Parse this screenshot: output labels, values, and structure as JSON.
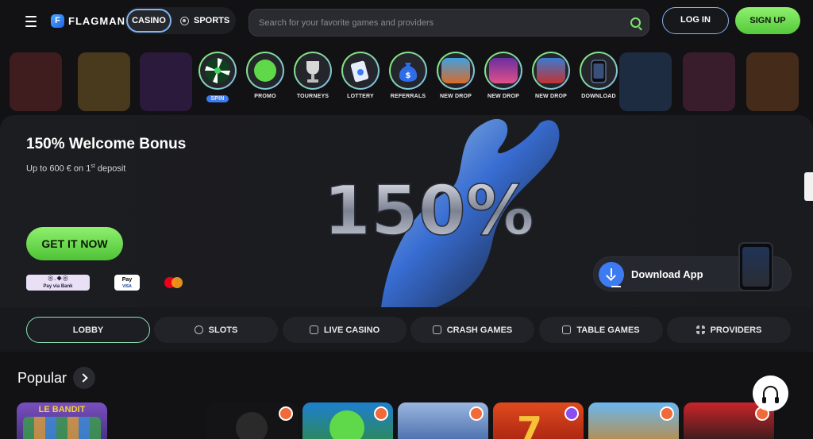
{
  "header": {
    "brand": "FLAGMAN",
    "brand_mark": "F",
    "mode_casino": "CASINO",
    "mode_sports": "SPORTS",
    "search_placeholder": "Search for your favorite games and providers",
    "login": "LOG IN",
    "signup": "SIGN UP"
  },
  "quick_links": [
    {
      "label": "SPIN",
      "icon": "wheel-icon",
      "color": "#1f8a3a"
    },
    {
      "label": "PROMO",
      "icon": "gift-icon",
      "color": "#5fd84a"
    },
    {
      "label": "TOURNEYS",
      "icon": "trophy-icon",
      "color": "#c9c9c9"
    },
    {
      "label": "LOTTERY",
      "icon": "ticket-icon",
      "color": "#9ab6e0"
    },
    {
      "label": "REFERRALS",
      "icon": "money-bag-icon",
      "color": "#2f6de8"
    },
    {
      "label": "NEW DROP",
      "icon": "game-thumb-icon",
      "color": "#d96b2a"
    },
    {
      "label": "NEW DROP",
      "icon": "game-thumb-icon",
      "color": "#a5285f"
    },
    {
      "label": "NEW DROP",
      "icon": "game-thumb-icon",
      "color": "#c23232"
    },
    {
      "label": "DOWNLOAD",
      "icon": "phone-icon",
      "color": "#3a4f7a"
    }
  ],
  "hero": {
    "title": "150% Welcome Bonus",
    "subtitle_prefix": "Up to 600 € on 1",
    "subtitle_sup": "st",
    "subtitle_suffix": " deposit",
    "big_text": "150%",
    "cta": "GET IT NOW",
    "pay_bank_dots": "ⓞ . ◆ ⓞ",
    "pay_bank": "Pay via Bank",
    "apple_pay": " Pay",
    "visa": "VISA",
    "download_app": "Download App"
  },
  "categories": [
    {
      "label": "LOBBY",
      "icon": ""
    },
    {
      "label": "SLOTS",
      "icon": "slots-icon"
    },
    {
      "label": "LIVE CASINO",
      "icon": "live-icon"
    },
    {
      "label": "CRASH GAMES",
      "icon": "crash-icon"
    },
    {
      "label": "TABLE GAMES",
      "icon": "dice-icon"
    },
    {
      "label": "PROVIDERS",
      "icon": "grid-icon"
    }
  ],
  "popular": {
    "title": "Popular",
    "games": [
      {
        "name": "LE BANDIT",
        "color": "#5a3fa0"
      },
      {
        "name": "",
        "color": "#1c1c1c"
      },
      {
        "name": "",
        "color": "#2f8a3e"
      },
      {
        "name": "",
        "color": "#5f7fc9"
      },
      {
        "name": "",
        "color": "#d63a1e"
      },
      {
        "name": "",
        "color": "#2b8fd6"
      },
      {
        "name": "",
        "color": "#c8242a"
      }
    ]
  }
}
